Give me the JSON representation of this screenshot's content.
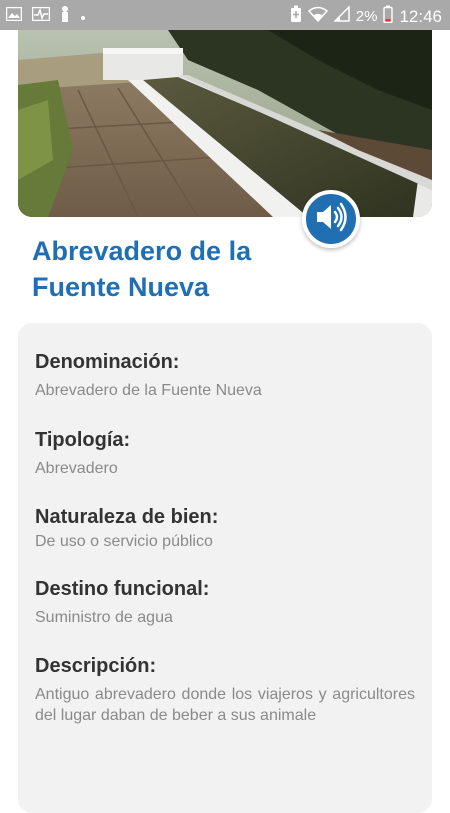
{
  "status_bar": {
    "time": "12:46",
    "battery_percent": "2%",
    "icons_left": [
      "image-icon",
      "activity-icon",
      "person-icon",
      "dot-icon"
    ],
    "icons_right": [
      "battery-saver-icon",
      "wifi-icon",
      "signal-icon",
      "battery-low-icon"
    ]
  },
  "place": {
    "title": "Abrevadero de la Fuente Nueva",
    "audio_icon": "speaker-icon"
  },
  "details": {
    "denominacion_label": "Denominación:",
    "denominacion_value": "Abrevadero de la Fuente Nueva",
    "tipologia_label": "Tipología:",
    "tipologia_value": "Abrevadero",
    "naturaleza_label": "Naturaleza de bien:",
    "naturaleza_value": "De uso o servicio público",
    "destino_label": "Destino funcional:",
    "destino_value": "Suministro de agua",
    "descripcion_label": "Descripción:",
    "descripcion_value": "Antiguo abrevadero donde los viajeros y agricultores del lugar daban de beber a sus animale"
  },
  "colors": {
    "accent": "#1f6fb2",
    "card_bg": "#f2f2f2",
    "status_bar": "#a9a9a9",
    "label_text": "#333333",
    "value_text": "#8a8a8a"
  }
}
